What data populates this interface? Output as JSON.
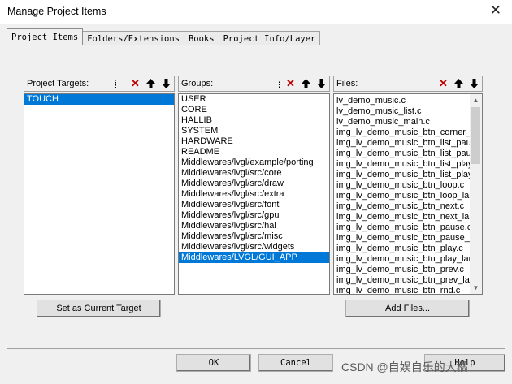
{
  "window": {
    "title": "Manage Project Items",
    "close_symbol": "✕"
  },
  "tabs": [
    {
      "label": "Project Items",
      "active": true
    },
    {
      "label": "Folders/Extensions",
      "active": false
    },
    {
      "label": "Books",
      "active": false
    },
    {
      "label": "Project Info/Layer",
      "active": false
    }
  ],
  "project_targets": {
    "label": "Project Targets:",
    "items": [
      "TOUCH"
    ],
    "selected_index": 0
  },
  "groups": {
    "label": "Groups:",
    "items": [
      "USER",
      "CORE",
      "HALLIB",
      "SYSTEM",
      "HARDWARE",
      "README",
      "Middlewares/lvgl/example/porting",
      "Middlewares/lvgl/src/core",
      "Middlewares/lvgl/src/draw",
      "Middlewares/lvgl/src/extra",
      "Middlewares/lvgl/src/font",
      "Middlewares/lvgl/src/gpu",
      "Middlewares/lvgl/src/hal",
      "Middlewares/lvgl/src/misc",
      "Middlewares/lvgl/src/widgets",
      "Middlewares/LVGL/GUI_APP"
    ],
    "selected_index": 15
  },
  "files": {
    "label": "Files:",
    "items": [
      "lv_demo_music.c",
      "lv_demo_music_list.c",
      "lv_demo_music_main.c",
      "img_lv_demo_music_btn_corner_la",
      "img_lv_demo_music_btn_list_paus",
      "img_lv_demo_music_btn_list_paus",
      "img_lv_demo_music_btn_list_play.c",
      "img_lv_demo_music_btn_list_play_",
      "img_lv_demo_music_btn_loop.c",
      "img_lv_demo_music_btn_loop_larg",
      "img_lv_demo_music_btn_next.c",
      "img_lv_demo_music_btn_next_larg",
      "img_lv_demo_music_btn_pause.c",
      "img_lv_demo_music_btn_pause_la",
      "img_lv_demo_music_btn_play.c",
      "img_lv_demo_music_btn_play_larg",
      "img_lv_demo_music_btn_prev.c",
      "img_lv_demo_music_btn_prev_larg",
      "img_lv_demo_music_btn_rnd.c"
    ],
    "scroll_position": 0.0
  },
  "buttons": {
    "set_current_target": "Set as Current Target",
    "add_files": "Add Files...",
    "ok": "OK",
    "cancel": "Cancel",
    "help": "Help"
  },
  "toolbar_icons": {
    "new": "new-item-icon",
    "delete": "delete-x-icon",
    "move_up": "arrow-up-icon",
    "move_down": "arrow-down-icon"
  },
  "watermark": "CSDN @自娱自乐的大橘",
  "colors": {
    "selection": "#0078d7",
    "delete_icon": "#c00000"
  }
}
